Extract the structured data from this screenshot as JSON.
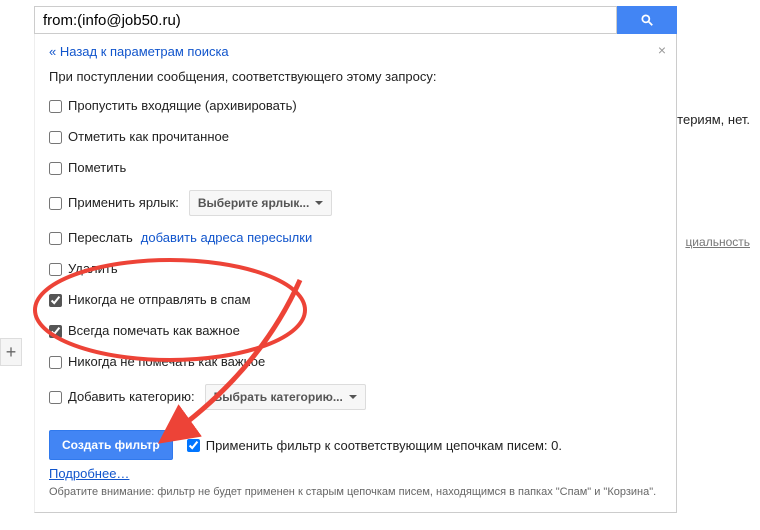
{
  "search": {
    "query": "from:(info@job50.ru)"
  },
  "bg": {
    "no_results_tail": "ритериям, нет.",
    "confidentiality": "циальность"
  },
  "panel": {
    "back": "« Назад к параметрам поиска",
    "intro": "При поступлении сообщения, соответствующего этому запросу:"
  },
  "opts": {
    "skip_inbox": "Пропустить входящие (архивировать)",
    "mark_read": "Отметить как прочитанное",
    "star": "Пометить",
    "apply_label": "Применить ярлык:",
    "label_select": "Выберите ярлык...",
    "forward": "Переслать",
    "forward_add": "добавить адреса пересылки",
    "delete": "Удалить",
    "never_spam": "Никогда не отправлять в спам",
    "always_important": "Всегда помечать как важное",
    "never_important": "Никогда не помечать как важное",
    "add_category": "Добавить категорию:",
    "category_select": "Выбрать категорию..."
  },
  "action": {
    "create": "Создать фильтр",
    "apply_existing": "Применить фильтр к соответствующим цепочкам писем: 0.",
    "more": "Подробнее…",
    "note": "Обратите внимание: фильтр не будет применен к старым цепочкам писем, находящимся в папках \"Спам\" и \"Корзина\"."
  }
}
